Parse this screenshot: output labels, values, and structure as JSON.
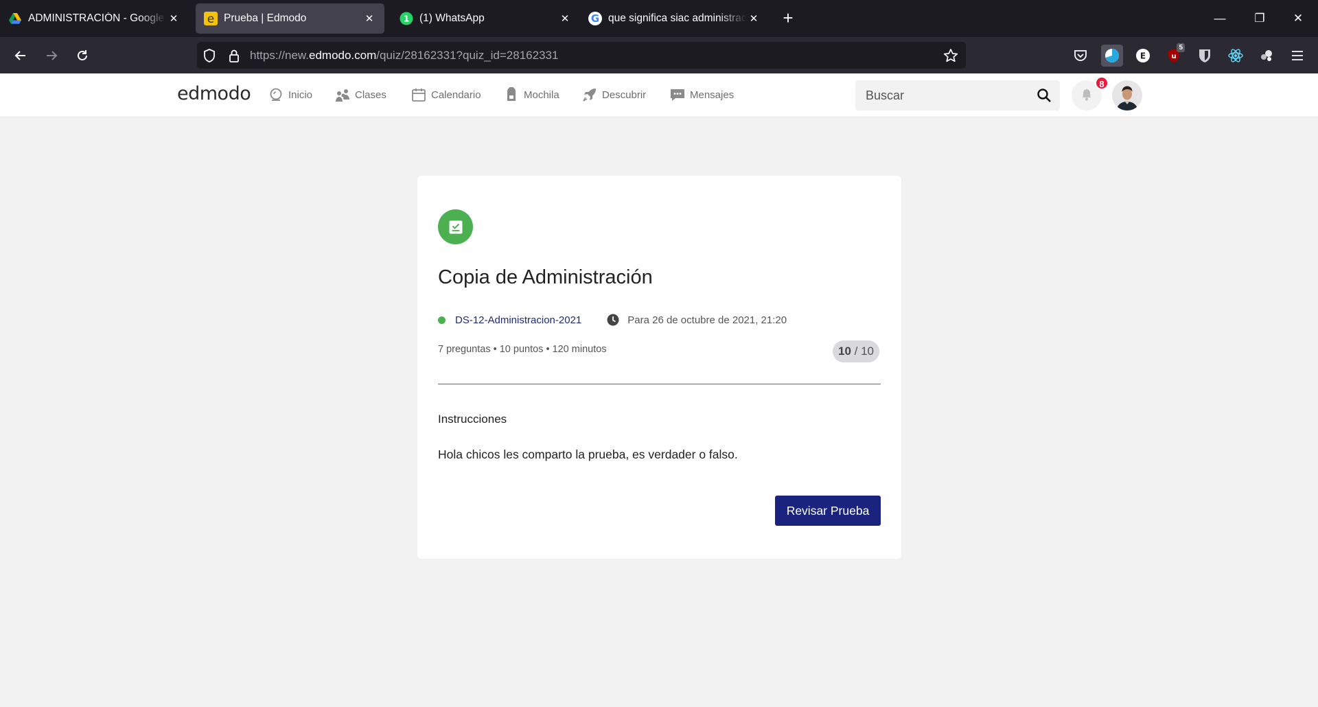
{
  "browser": {
    "tabs": [
      {
        "title": "ADMINISTRACIÓN - Google Drive",
        "favicon": "google-drive-icon",
        "active": false
      },
      {
        "title": "Prueba | Edmodo",
        "favicon": "edmodo-icon",
        "active": true
      },
      {
        "title": "(1) WhatsApp",
        "favicon": "whatsapp-icon",
        "active": false,
        "favicon_badge": "1"
      },
      {
        "title": "que significa siac administracion - Buscar con Google",
        "favicon": "google-icon",
        "active": false
      }
    ],
    "new_tab_label": "+",
    "url": {
      "scheme": "https://new.",
      "host": "edmodo.com",
      "path": "/quiz/28162331?quiz_id=28162331"
    },
    "extension_badge": "5"
  },
  "edmodo": {
    "logo": "edmodo",
    "nav": [
      {
        "label": "Inicio",
        "icon": "home-icon"
      },
      {
        "label": "Clases",
        "icon": "classes-icon"
      },
      {
        "label": "Calendario",
        "icon": "calendar-icon"
      },
      {
        "label": "Mochila",
        "icon": "backpack-icon"
      },
      {
        "label": "Descubrir",
        "icon": "rocket-icon"
      },
      {
        "label": "Mensajes",
        "icon": "messages-icon"
      }
    ],
    "search_placeholder": "Buscar",
    "notifications_count": "8"
  },
  "quiz": {
    "title": "Copia de Administración",
    "class_name": "DS-12-Administracion-2021",
    "due": "Para 26 de octubre de 2021, 21:20",
    "stats": "7 preguntas • 10 puntos • 120 minutos",
    "score_obtained": "10",
    "score_separator": " / ",
    "score_total": "10",
    "instructions_heading": "Instrucciones",
    "instructions_text": "Hola chicos les comparto la prueba, es verdader o falso.",
    "review_button": "Revisar Prueba"
  },
  "colors": {
    "accent": "#1a237e",
    "quiz_icon": "#4caf50",
    "notification_badge": "#e8193c",
    "class_link": "#1c2b7a"
  }
}
